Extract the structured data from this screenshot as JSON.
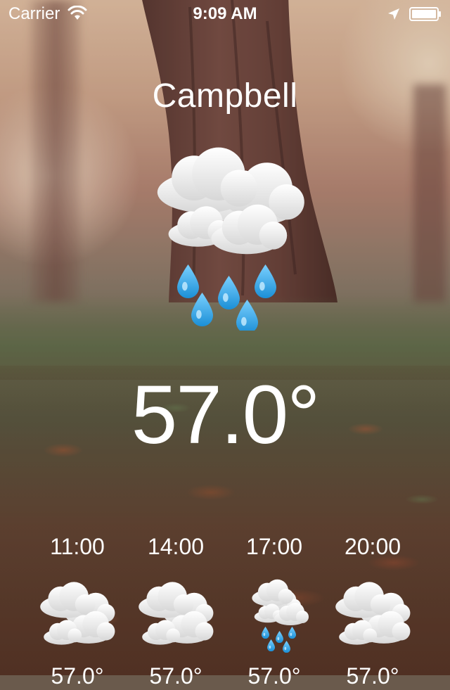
{
  "status_bar": {
    "carrier": "Carrier",
    "time": "9:09 AM",
    "icons": [
      "wifi-icon",
      "location-arrow-icon",
      "battery-icon"
    ]
  },
  "current": {
    "city": "Campbell",
    "temperature": "57.0°",
    "condition_icon": "cloud-rain-icon"
  },
  "hourly": [
    {
      "time": "11:00",
      "icon": "cloudy-icon",
      "temp": "57.0°"
    },
    {
      "time": "14:00",
      "icon": "cloudy-icon",
      "temp": "57.0°"
    },
    {
      "time": "17:00",
      "icon": "cloud-rain-icon",
      "temp": "57.0°"
    },
    {
      "time": "20:00",
      "icon": "cloudy-icon",
      "temp": "57.0°"
    }
  ],
  "colors": {
    "text": "#ffffff",
    "rain_drop": "#2aa2e6",
    "cloud": "#f1f1f1"
  }
}
